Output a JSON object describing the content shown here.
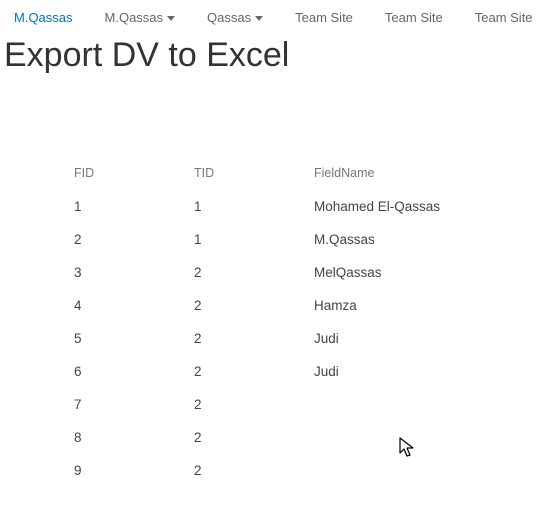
{
  "nav": {
    "items": [
      {
        "label": "M.Qassas",
        "active": true,
        "caret": false
      },
      {
        "label": "M.Qassas",
        "active": false,
        "caret": true
      },
      {
        "label": "Qassas",
        "active": false,
        "caret": true
      },
      {
        "label": "Team Site",
        "active": false,
        "caret": false
      },
      {
        "label": "Team Site",
        "active": false,
        "caret": false
      },
      {
        "label": "Team Site",
        "active": false,
        "caret": false
      }
    ]
  },
  "page": {
    "title": "Export DV to Excel"
  },
  "table": {
    "columns": {
      "fid": "FID",
      "tid": "TID",
      "fieldname": "FieldName"
    },
    "rows": [
      {
        "fid": "1",
        "tid": "1",
        "fieldname": "Mohamed El-Qassas"
      },
      {
        "fid": "2",
        "tid": "1",
        "fieldname": "M.Qassas"
      },
      {
        "fid": "3",
        "tid": "2",
        "fieldname": "MelQassas"
      },
      {
        "fid": "4",
        "tid": "2",
        "fieldname": "Hamza"
      },
      {
        "fid": "5",
        "tid": "2",
        "fieldname": "Judi"
      },
      {
        "fid": "6",
        "tid": "2",
        "fieldname": "Judi"
      },
      {
        "fid": "7",
        "tid": "2",
        "fieldname": ""
      },
      {
        "fid": "8",
        "tid": "2",
        "fieldname": ""
      },
      {
        "fid": "9",
        "tid": "2",
        "fieldname": ""
      }
    ]
  },
  "icons": {
    "caret_down": "caret-down-icon",
    "cursor": "cursor-icon"
  }
}
